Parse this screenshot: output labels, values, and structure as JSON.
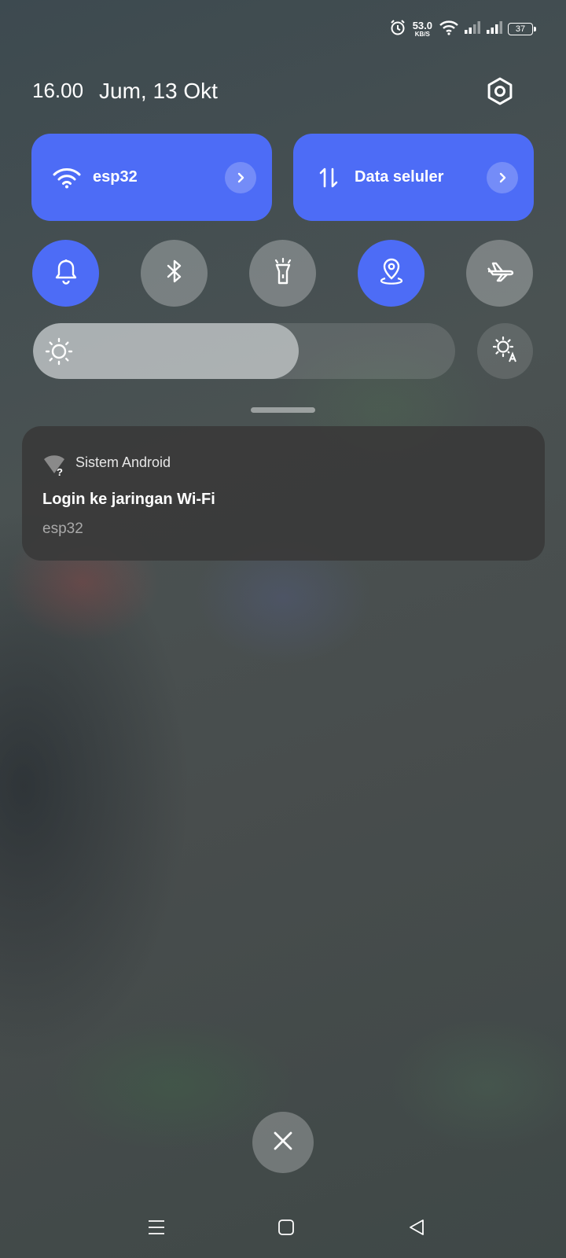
{
  "status_bar": {
    "speed_value": "53.0",
    "speed_unit": "KB/S",
    "battery_level": "37",
    "icons": [
      "alarm-icon",
      "wifi-icon",
      "signal-sim1-icon",
      "signal-sim2-icon",
      "battery-icon"
    ]
  },
  "header": {
    "time": "16.00",
    "date": "Jum, 13 Okt",
    "settings_icon": "gear-icon"
  },
  "tiles": [
    {
      "label": "esp32",
      "icon": "wifi-icon",
      "active": true
    },
    {
      "label": "Data seluler",
      "icon": "mobile-data-icon",
      "active": true
    }
  ],
  "toggles": [
    {
      "name": "sound",
      "icon": "bell-icon",
      "active": true
    },
    {
      "name": "bluetooth",
      "icon": "bluetooth-icon",
      "active": false
    },
    {
      "name": "flashlight",
      "icon": "flashlight-icon",
      "active": false
    },
    {
      "name": "location",
      "icon": "location-icon",
      "active": true
    },
    {
      "name": "airplane-mode",
      "icon": "airplane-icon",
      "active": false
    }
  ],
  "brightness": {
    "level": 0.63,
    "auto_icon": "auto-brightness-icon"
  },
  "notification": {
    "app_name": "Sistem Android",
    "title": "Login ke jaringan Wi-Fi",
    "body": "esp32",
    "icon": "wifi-question-icon"
  },
  "nav_bar": {
    "buttons": [
      "menu-icon",
      "home-icon",
      "back-icon"
    ]
  },
  "colors": {
    "accent": "#4d6cf6",
    "card": "#3a3a3a"
  }
}
